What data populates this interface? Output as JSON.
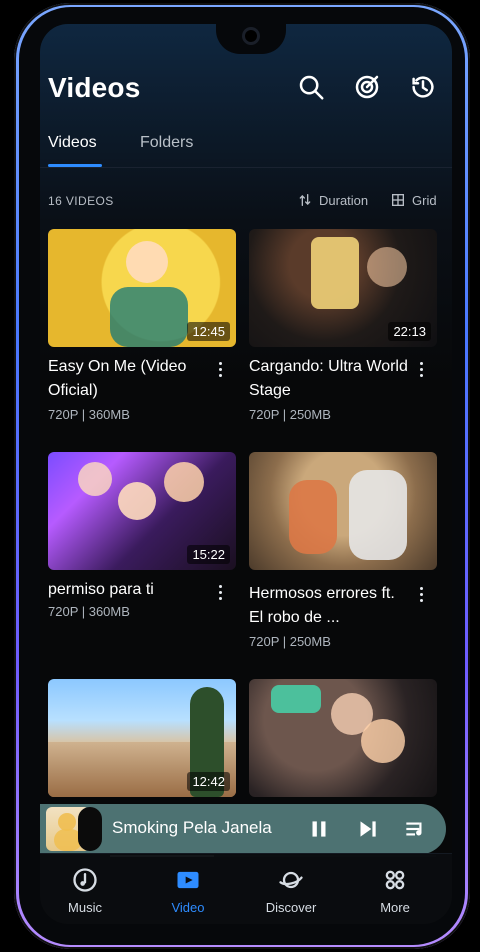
{
  "header": {
    "title": "Videos",
    "icons": [
      "search-icon",
      "target-icon",
      "history-icon"
    ]
  },
  "tabs": [
    {
      "label": "Videos",
      "active": true
    },
    {
      "label": "Folders",
      "active": false
    }
  ],
  "toolbar": {
    "count_label": "16 VIDEOS",
    "sort_label": "Duration",
    "view_label": "Grid"
  },
  "videos": [
    {
      "title": "Easy On Me (Video Oficial)",
      "meta": "720P | 360MB",
      "duration": "12:45"
    },
    {
      "title": "Cargando: Ultra World Stage",
      "meta": "720P | 250MB",
      "duration": "22:13"
    },
    {
      "title": "permiso para ti",
      "meta": "720P | 360MB",
      "duration": "15:22"
    },
    {
      "title": "Hermosos errores ft. El robo de ...",
      "meta": "720P | 250MB",
      "duration": ""
    },
    {
      "title": "",
      "meta": "",
      "duration": "12:42"
    },
    {
      "title": "",
      "meta": "",
      "duration": ""
    }
  ],
  "mini_player": {
    "title": "Smoking Pela Janela",
    "progress_fraction": 0.32
  },
  "bottom_nav": [
    {
      "label": "Music",
      "icon": "music-disc-icon",
      "active": false
    },
    {
      "label": "Video",
      "icon": "video-play-icon",
      "active": true
    },
    {
      "label": "Discover",
      "icon": "planet-icon",
      "active": false
    },
    {
      "label": "More",
      "icon": "grid-more-icon",
      "active": false
    }
  ],
  "colors": {
    "accent": "#2e8cff",
    "mini_player_bg": "#4d7272"
  }
}
